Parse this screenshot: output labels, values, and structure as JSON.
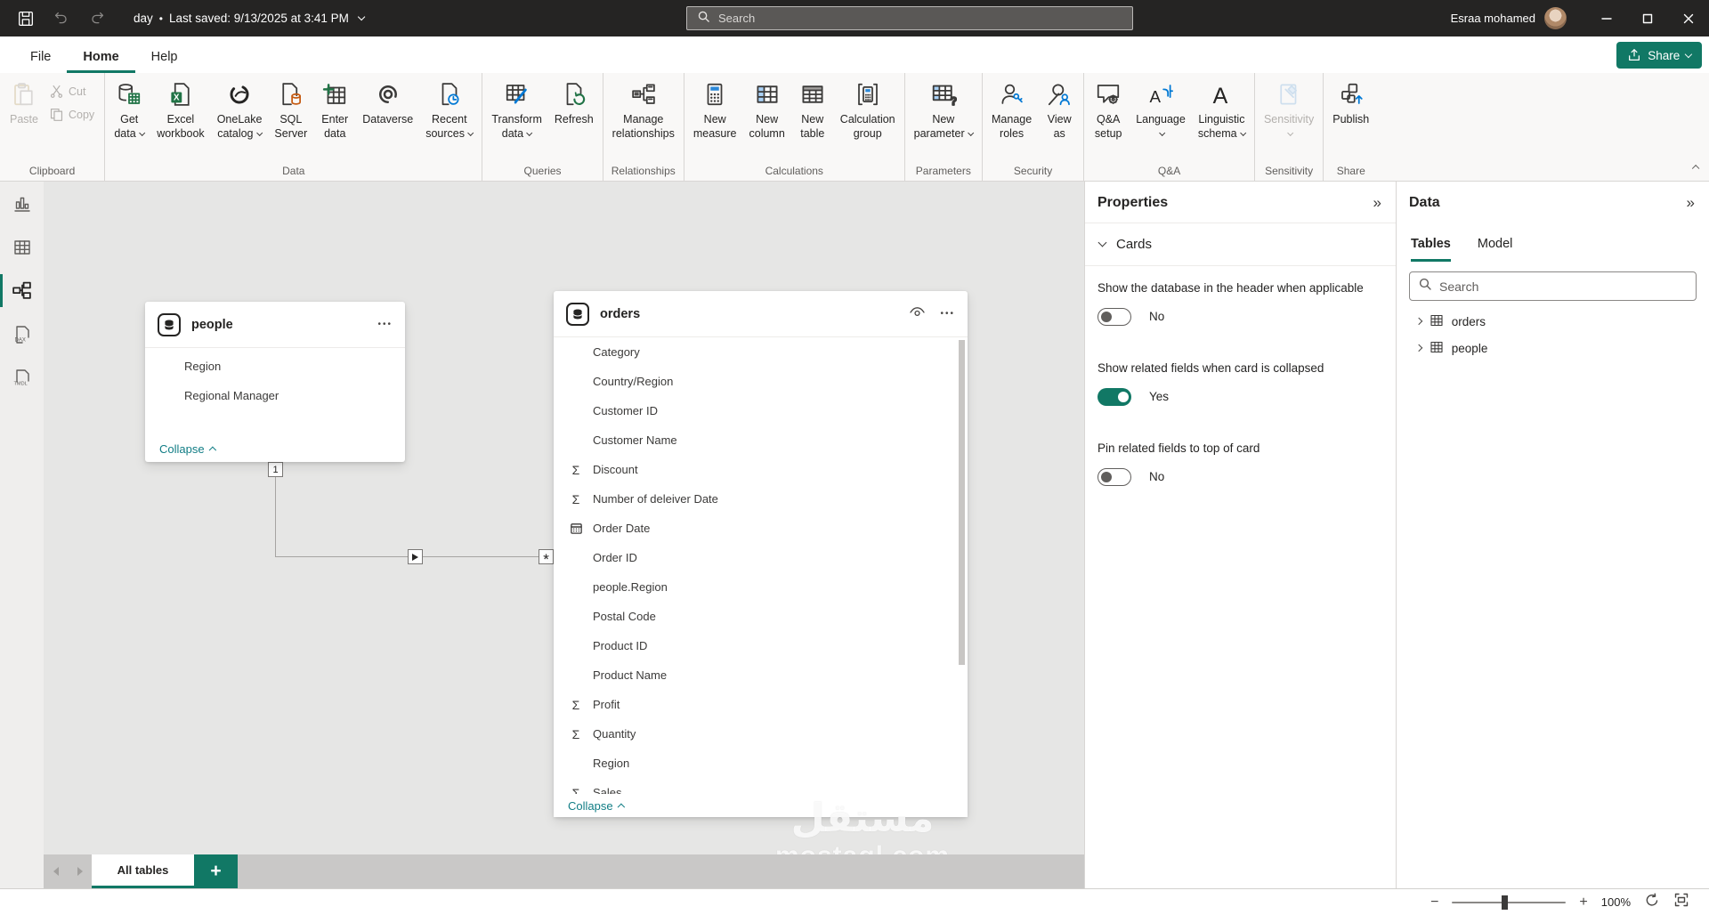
{
  "titlebar": {
    "document_name": "day",
    "separator": "•",
    "last_saved": "Last saved: 9/13/2025 at 3:41 PM",
    "search_placeholder": "Search",
    "user_name": "Esraa mohamed"
  },
  "menubar": {
    "items": [
      "File",
      "Home",
      "Help"
    ],
    "active": "Home"
  },
  "share_button": {
    "label": "Share"
  },
  "ribbon": {
    "groups": [
      {
        "label": "Clipboard",
        "paste": {
          "label": "Paste",
          "disabled": true
        },
        "cut": {
          "label": "Cut",
          "disabled": true
        },
        "copy": {
          "label": "Copy",
          "disabled": true
        }
      },
      {
        "label": "Data",
        "buttons": [
          {
            "line1": "Get",
            "line2": "data",
            "caret": true
          },
          {
            "line1": "Excel",
            "line2": "workbook"
          },
          {
            "line1": "OneLake",
            "line2": "catalog",
            "caret": true
          },
          {
            "line1": "SQL",
            "line2": "Server"
          },
          {
            "line1": "Enter",
            "line2": "data"
          },
          {
            "line1": "Dataverse",
            "line2": ""
          },
          {
            "line1": "Recent",
            "line2": "sources",
            "caret": true
          }
        ]
      },
      {
        "label": "Queries",
        "buttons": [
          {
            "line1": "Transform",
            "line2": "data",
            "caret": true
          },
          {
            "line1": "Refresh",
            "line2": ""
          }
        ]
      },
      {
        "label": "Relationships",
        "buttons": [
          {
            "line1": "Manage",
            "line2": "relationships"
          }
        ]
      },
      {
        "label": "Calculations",
        "buttons": [
          {
            "line1": "New",
            "line2": "measure"
          },
          {
            "line1": "New",
            "line2": "column"
          },
          {
            "line1": "New",
            "line2": "table"
          },
          {
            "line1": "Calculation",
            "line2": "group"
          }
        ]
      },
      {
        "label": "Parameters",
        "buttons": [
          {
            "line1": "New",
            "line2": "parameter",
            "caret": true
          }
        ]
      },
      {
        "label": "Security",
        "buttons": [
          {
            "line1": "Manage",
            "line2": "roles"
          },
          {
            "line1": "View",
            "line2": "as"
          }
        ]
      },
      {
        "label": "Q&A",
        "buttons": [
          {
            "line1": "Q&A",
            "line2": "setup"
          },
          {
            "line1": "Language",
            "line2": "",
            "caret": true
          },
          {
            "line1": "Linguistic",
            "line2": "schema",
            "caret": true
          }
        ]
      },
      {
        "label": "Sensitivity",
        "buttons": [
          {
            "line1": "Sensitivity",
            "line2": "",
            "caret": true,
            "disabled": true
          }
        ]
      },
      {
        "label": "Share",
        "buttons": [
          {
            "line1": "Publish",
            "line2": ""
          }
        ]
      }
    ]
  },
  "left_nav": {
    "items": [
      {
        "icon": "report-view-icon",
        "active": false
      },
      {
        "icon": "table-view-icon",
        "active": false
      },
      {
        "icon": "model-view-icon",
        "active": true
      },
      {
        "icon": "dax-query-view-icon",
        "active": false
      },
      {
        "icon": "tmdl-view-icon",
        "active": false
      }
    ]
  },
  "canvas": {
    "people_table": {
      "title": "people",
      "fields": [
        {
          "name": "Region"
        },
        {
          "name": "Regional Manager"
        }
      ],
      "collapse_label": "Collapse"
    },
    "orders_table": {
      "title": "orders",
      "fields": [
        {
          "name": "Category"
        },
        {
          "name": "Country/Region"
        },
        {
          "name": "Customer ID"
        },
        {
          "name": "Customer Name"
        },
        {
          "name": "Discount",
          "icon": "sigma"
        },
        {
          "name": "Number of deleiver Date",
          "icon": "sigma"
        },
        {
          "name": "Order Date",
          "icon": "calendar"
        },
        {
          "name": "Order ID"
        },
        {
          "name": "people.Region"
        },
        {
          "name": "Postal Code"
        },
        {
          "name": "Product ID"
        },
        {
          "name": "Product Name"
        },
        {
          "name": "Profit",
          "icon": "sigma"
        },
        {
          "name": "Quantity",
          "icon": "sigma"
        },
        {
          "name": "Region"
        },
        {
          "name": "Sales",
          "icon": "sigma"
        }
      ],
      "collapse_label": "Collapse"
    },
    "relationship": {
      "one_label": "1",
      "many_label": "*"
    },
    "watermark": {
      "line1": "مستقل",
      "line2": "mostaql.com"
    }
  },
  "properties_panel": {
    "title": "Properties",
    "section_label": "Cards",
    "settings": [
      {
        "label": "Show the database in the header when applicable",
        "value": "No",
        "on": false
      },
      {
        "label": "Show related fields when card is collapsed",
        "value": "Yes",
        "on": true
      },
      {
        "label": "Pin related fields to top of card",
        "value": "No",
        "on": false
      }
    ]
  },
  "data_panel": {
    "title": "Data",
    "tabs": [
      {
        "label": "Tables",
        "active": true
      },
      {
        "label": "Model",
        "active": false
      }
    ],
    "search_placeholder": "Search",
    "tables": [
      {
        "name": "orders"
      },
      {
        "name": "people"
      }
    ]
  },
  "canvas_tabs": {
    "active_tab": "All tables"
  },
  "status_bar": {
    "zoom_level": "100%"
  },
  "icons_text": {
    "sigma": "Σ",
    "more_options": "•••",
    "collapse_panel": "»"
  }
}
